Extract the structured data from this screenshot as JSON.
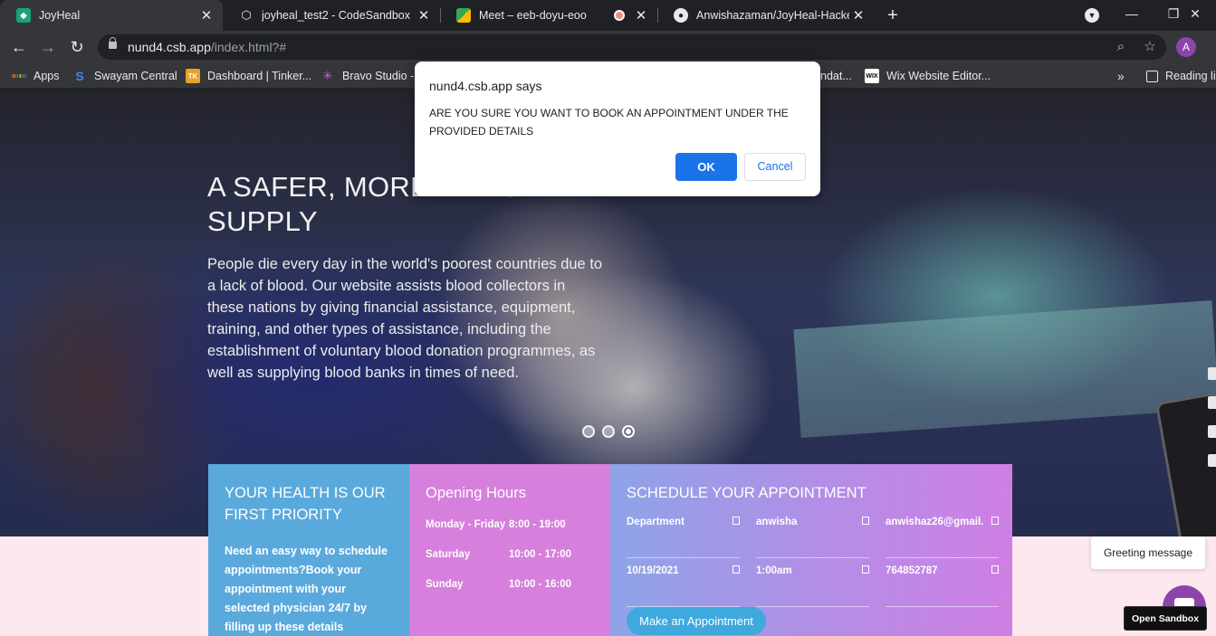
{
  "browser": {
    "tabs": [
      {
        "title": "JoyHeal",
        "active": true
      },
      {
        "title": "joyheal_test2 - CodeSandbox",
        "active": false
      },
      {
        "title": "Meet – eeb-doyu-eoo",
        "active": false
      },
      {
        "title": "Anwishazaman/JoyHeal-HackeRa",
        "active": false
      }
    ],
    "new_tab": "+",
    "url_host": "nund4.csb.app",
    "url_path": "/index.html?#",
    "profile_initial": "A",
    "bookmarks": [
      {
        "label": "Apps"
      },
      {
        "label": "Swayam Central"
      },
      {
        "label": "Dashboard | Tinker..."
      },
      {
        "label": "Bravo Studio - ..."
      },
      {
        "label": "ndat..."
      },
      {
        "label": "Wix Website Editor..."
      }
    ],
    "more_bookmarks": "»",
    "reading_list": "Reading lis"
  },
  "dialog": {
    "title": "nund4.csb.app says",
    "message": "ARE YOU SURE YOU WANT TO BOOK AN APPOINTMENT UNDER THE PROVIDED DETAILS",
    "ok": "OK",
    "cancel": "Cancel"
  },
  "hero": {
    "title": "A SAFER, MORE EFFICIENT SUPPLY",
    "text": "People die every day in the world's poorest countries due to a lack of blood. Our website assists blood collectors in these nations by giving financial assistance, equipment, training, and other types of assistance, including the establishment of voluntary blood donation programmes, as well as supplying blood banks in times of need.",
    "slides": 3,
    "active_slide": 3
  },
  "panels": {
    "health": {
      "title": "YOUR HEALTH IS OUR FIRST PRIORITY",
      "body": "Need an easy way to schedule appointments?Book your appointment with your selected physician 24/7 by filling up these details"
    },
    "hours": {
      "title": "Opening Hours",
      "rows": [
        {
          "day": "Monday - Friday",
          "time": "8:00 - 19:00"
        },
        {
          "day": "Saturday",
          "time": "10:00 - 17:00"
        },
        {
          "day": "Sunday",
          "time": "10:00 - 16:00"
        }
      ]
    },
    "schedule": {
      "title": "SCHEDULE YOUR APPOINTMENT",
      "fields": [
        {
          "value": "Department"
        },
        {
          "value": "anwisha"
        },
        {
          "value": "anwishaz26@gmail."
        },
        {
          "value": "10/19/2021"
        },
        {
          "value": "1:00am"
        },
        {
          "value": "764852787"
        }
      ],
      "button": "Make an Appointment"
    }
  },
  "widgets": {
    "greeting": "Greeting message",
    "open_sandbox": "Open Sandbox"
  },
  "colors": {
    "panel_health": "#5aa9dc",
    "panel_hours": "#d77fdc",
    "dialog_ok": "#1a73e8",
    "chat_fab": "#8e44ad"
  }
}
